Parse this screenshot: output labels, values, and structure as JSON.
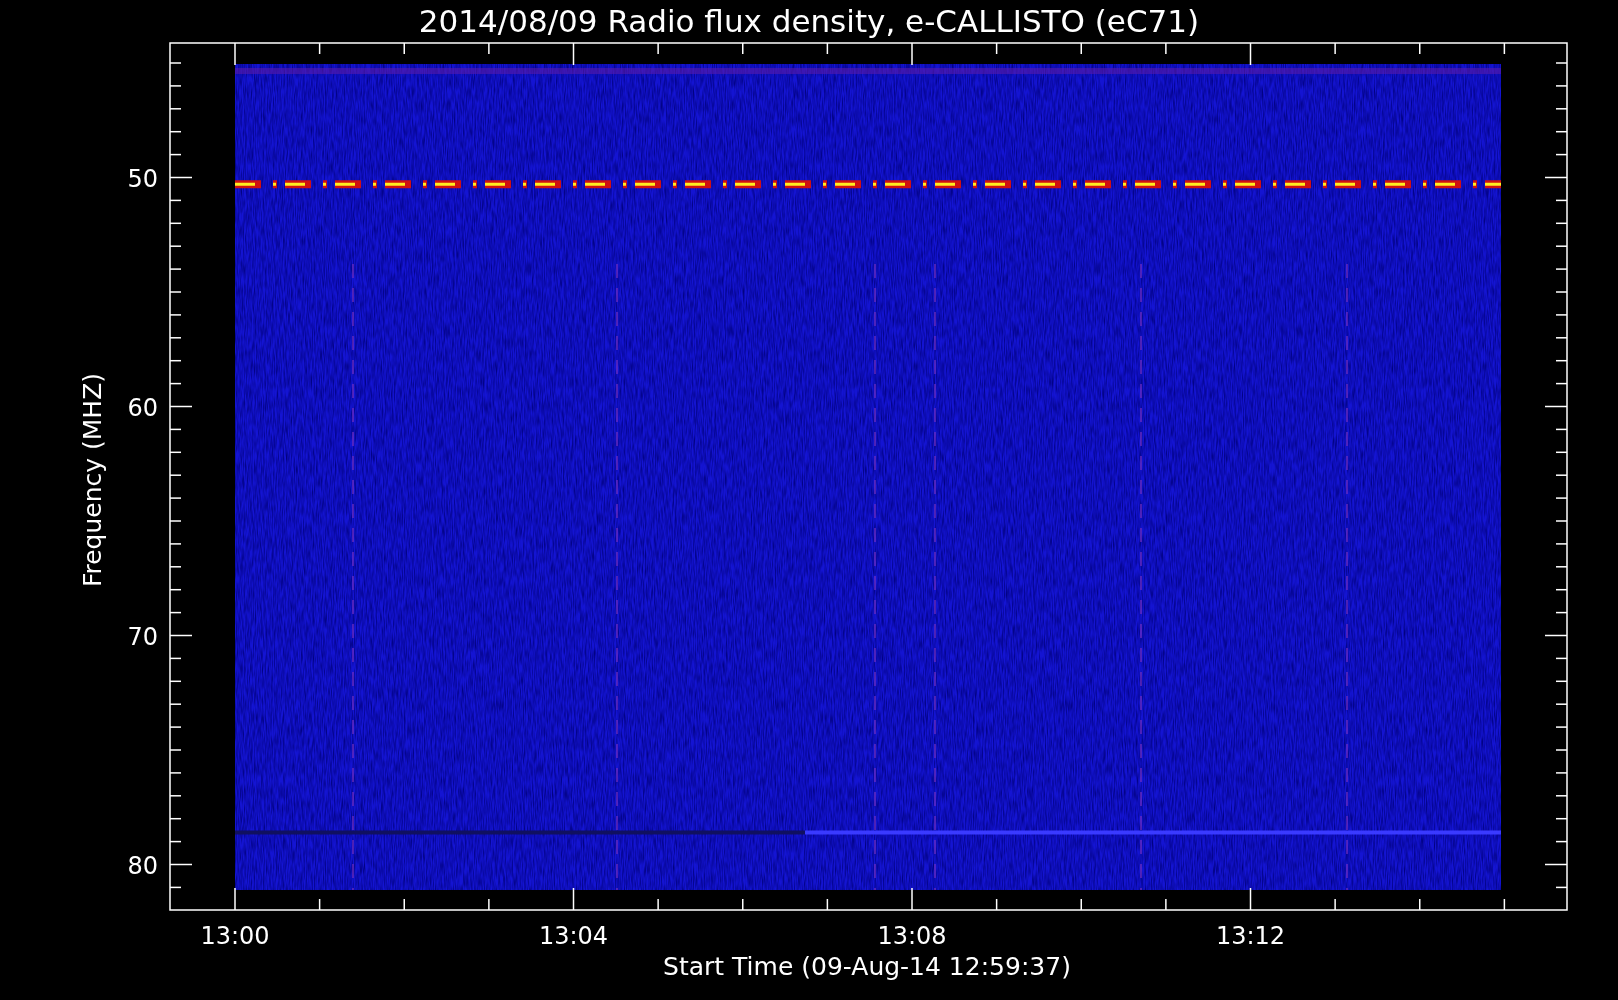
{
  "plot": {
    "title": "2014/08/09  Radio flux density, e-CALLISTO (eC71)",
    "xlabel": "Start Time (09-Aug-14 12:59:37)",
    "ylabel": "Frequency (MHZ)",
    "x_tick_labels": [
      "13:00",
      "13:04",
      "13:08",
      "13:12"
    ],
    "y_tick_labels": [
      "50",
      "60",
      "70",
      "80"
    ]
  }
}
